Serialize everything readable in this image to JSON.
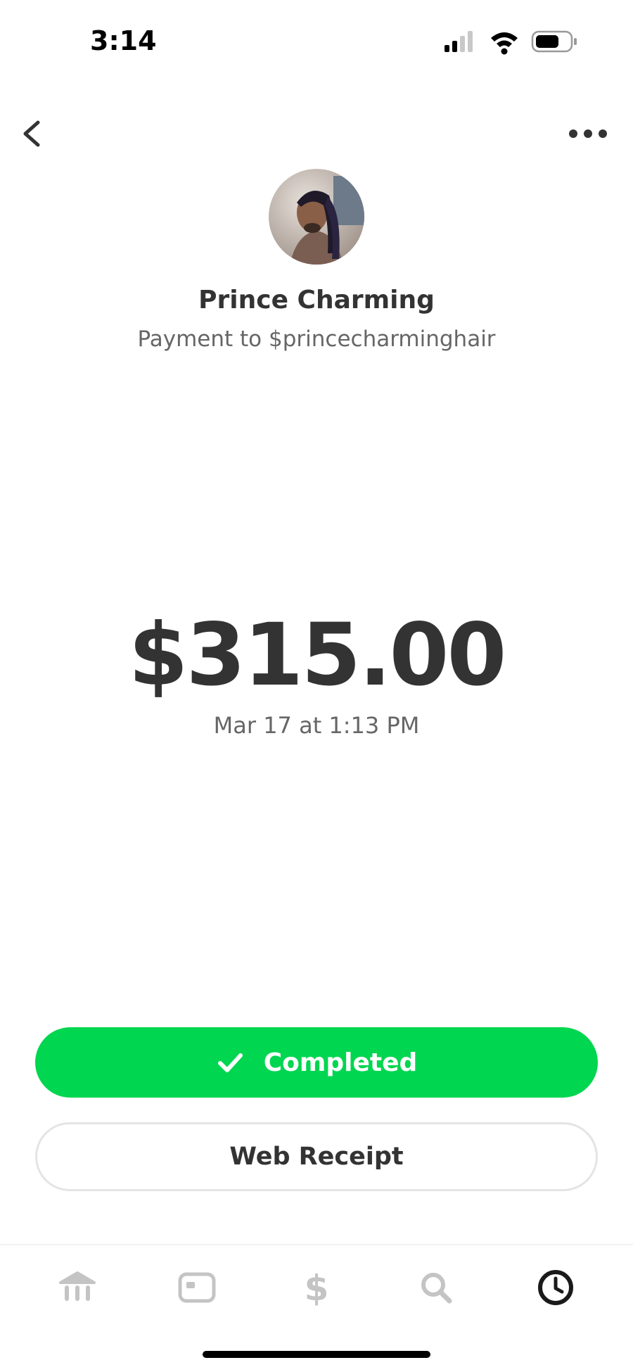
{
  "status_bar": {
    "time": "3:14"
  },
  "nav": {
    "back_icon": "chevron-left-icon",
    "more_icon": "more-horizontal-icon"
  },
  "payment": {
    "name": "Prince Charming",
    "subtitle": "Payment to $princecharminghair",
    "amount": "$315.00",
    "date": "Mar 17 at 1:13 PM"
  },
  "actions": {
    "completed_label": "Completed",
    "receipt_label": "Web Receipt"
  },
  "tabs": [
    {
      "icon": "bank-icon",
      "active": false
    },
    {
      "icon": "card-icon",
      "active": false
    },
    {
      "icon": "dollar-icon",
      "active": false
    },
    {
      "icon": "search-icon",
      "active": false
    },
    {
      "icon": "clock-icon",
      "active": true
    }
  ],
  "colors": {
    "accent_green": "#00d64f",
    "text_dark": "#333333",
    "text_muted": "#666666",
    "tab_inactive": "#c4c4c4"
  }
}
